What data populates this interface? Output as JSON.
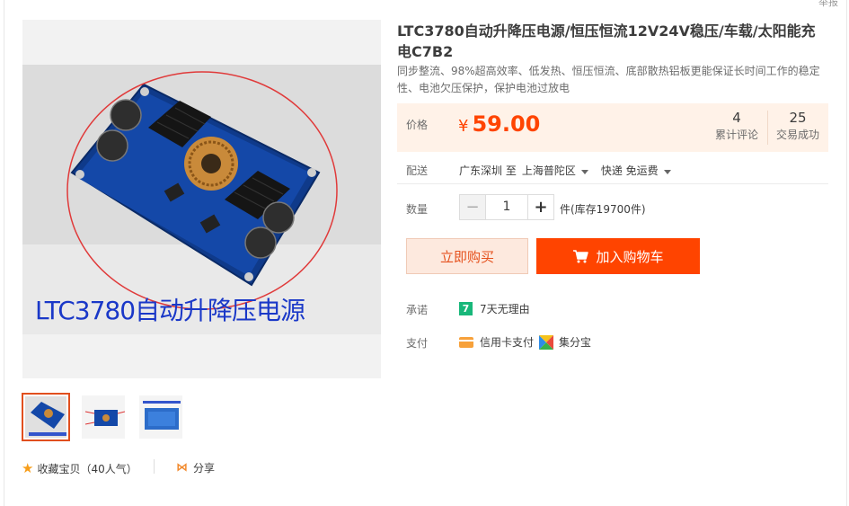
{
  "report": "举报",
  "product": {
    "title": "LTC3780自动升降压电源/恒压恒流12V24V稳压/车载/太阳能充电C7B2",
    "subtitle": "同步整流、98%超高效率、低发热、恒压恒流、底部散热铝板更能保证长时间工作的稳定性、电池欠压保护，保护电池过放电",
    "image_caption": "LTC3780自动升降压电源"
  },
  "price": {
    "label": "价格",
    "currency": "¥",
    "value": "59.00"
  },
  "stats": {
    "reviews_count": "4",
    "reviews_label": "累计评论",
    "sales_count": "25",
    "sales_label": "交易成功"
  },
  "delivery": {
    "label": "配送",
    "from": "广东深圳 至",
    "to": "上海普陀区",
    "method": "快递 免运费"
  },
  "quantity": {
    "label": "数量",
    "value": "1",
    "minus": "−",
    "plus": "+",
    "stock": "件(库存19700件)"
  },
  "buttons": {
    "buy_now": "立即购买",
    "add_to_cart": "加入购物车"
  },
  "promise": {
    "label": "承诺",
    "icon_text": "7",
    "text": "7天无理由"
  },
  "payment": {
    "label": "支付",
    "option1": "信用卡支付",
    "option2": "集分宝"
  },
  "favorite": {
    "text": "收藏宝贝（40人气）"
  },
  "share": {
    "text": "分享"
  },
  "colors": {
    "price": "#ff4400",
    "cart_button": "#ff4400",
    "price_bg": "#fff2e8"
  }
}
